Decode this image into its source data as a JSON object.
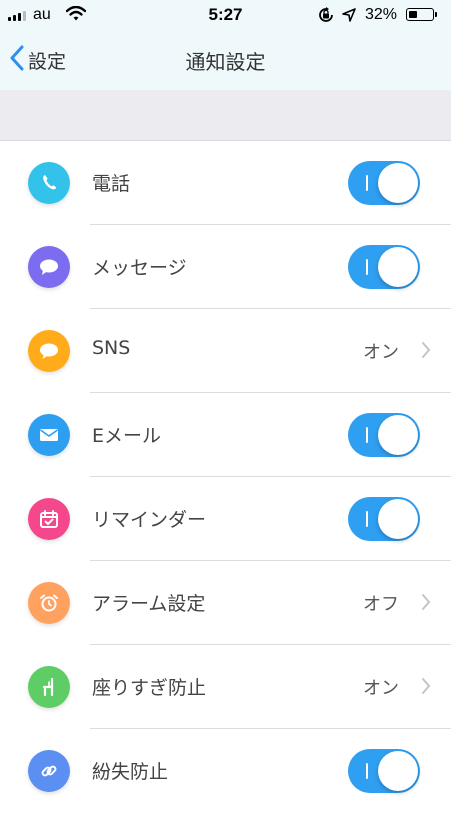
{
  "status_bar": {
    "carrier": "au",
    "time": "5:27",
    "battery": "32%"
  },
  "nav": {
    "back_label": "設定",
    "title": "通知設定"
  },
  "settings": [
    {
      "label": "電話",
      "control": "toggle",
      "on": true,
      "icon": "phone-icon",
      "color": "#33c3ea"
    },
    {
      "label": "メッセージ",
      "control": "toggle",
      "on": true,
      "icon": "message-bubble-icon",
      "color": "#7b6cf0"
    },
    {
      "label": "SNS",
      "control": "value",
      "value": "オン",
      "icon": "sns-bubble-icon",
      "color": "#ffab1a"
    },
    {
      "label": "Eメール",
      "control": "toggle",
      "on": true,
      "icon": "mail-icon",
      "color": "#2e9ff0"
    },
    {
      "label": "リマインダー",
      "control": "toggle",
      "on": true,
      "icon": "calendar-check-icon",
      "color": "#f5478b"
    },
    {
      "label": "アラーム設定",
      "control": "value",
      "value": "オフ",
      "icon": "alarm-clock-icon",
      "color": "#ffa25f"
    },
    {
      "label": "座りすぎ防止",
      "control": "value",
      "value": "オン",
      "icon": "chair-icon",
      "color": "#5fcd65"
    },
    {
      "label": "紛失防止",
      "control": "toggle",
      "on": true,
      "icon": "link-icon",
      "color": "#5b8ff2"
    }
  ]
}
